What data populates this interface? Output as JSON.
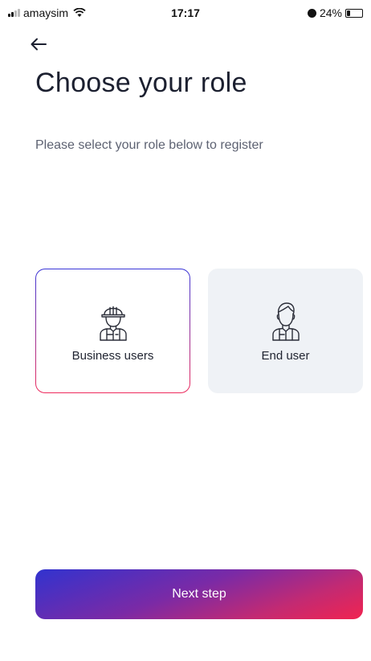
{
  "status_bar": {
    "carrier": "amaysim",
    "time": "17:17",
    "battery_text": "24%",
    "battery_level": 0.24
  },
  "page": {
    "title": "Choose your role",
    "subtitle": "Please select your role below to register"
  },
  "roles": [
    {
      "label": "Business users",
      "icon": "worker-hardhat-icon",
      "selected": true
    },
    {
      "label": "End user",
      "icon": "person-icon",
      "selected": false
    }
  ],
  "next_button": {
    "label": "Next step"
  },
  "colors": {
    "accent_start": "#3133cf",
    "accent_end": "#f12450",
    "card_unselected_bg": "#eff2f6"
  }
}
